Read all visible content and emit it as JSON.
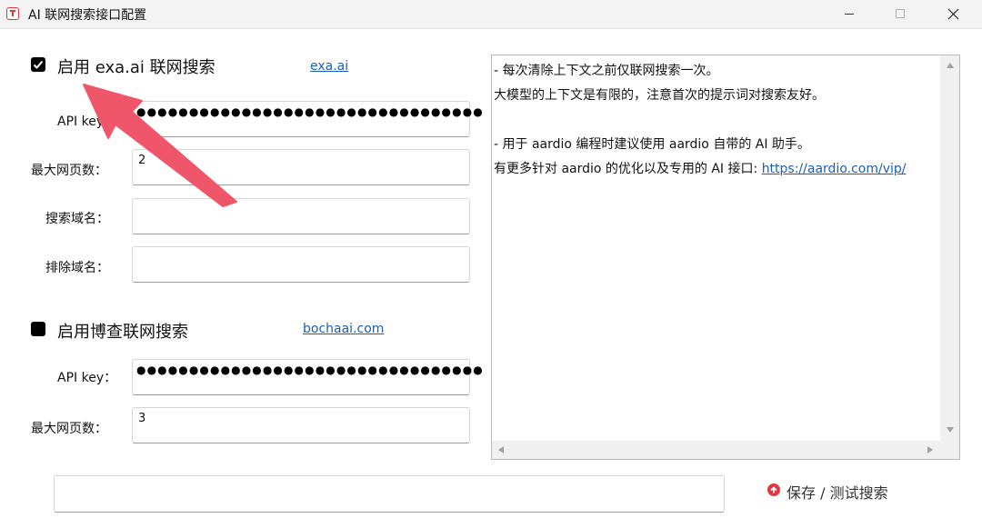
{
  "window": {
    "title": "AI 联网搜索接口配置"
  },
  "exa": {
    "enabled": true,
    "label": "启用 exa.ai 联网搜索",
    "link": "exa.ai",
    "api_key_label": "API key：",
    "api_key_masked": "●●●●●●●●●●●●●●●●●●●●●●●●●●●●●●●●●",
    "max_pages_label": "最大网页数：",
    "max_pages_value": "2",
    "search_domains_label": "搜索域名：",
    "search_domains_value": "",
    "exclude_domains_label": "排除域名：",
    "exclude_domains_value": ""
  },
  "bocha": {
    "enabled": false,
    "label": "启用博查联网搜索",
    "link": "bochaai.com",
    "api_key_label": "API key：",
    "api_key_masked": "●●●●●●●●●●●●●●●●●●●●●●●●●●●●●●●●●",
    "max_pages_label": "最大网页数：",
    "max_pages_value": "3"
  },
  "info": {
    "line1": "- 每次清除上下文之前仅联网搜索一次。",
    "line2": "大模型的上下文是有限的，注意首次的提示词对搜索友好。",
    "line3": "",
    "line4": "- 用于 aardio 编程时建议使用 aardio 自带的 AI 助手。",
    "line5_prefix": "有更多针对 aardio 的优化以及专用的 AI 接口: ",
    "line5_link": "https://aardio.com/vip/"
  },
  "actions": {
    "status_text": "",
    "save_label": "保存 / 测试搜索"
  },
  "colors": {
    "accent": "#e0383e",
    "link": "#1a5fb4",
    "annotation_arrow": "#f0566a"
  },
  "icons": {
    "app": "app-icon",
    "save": "arrow-up-circle-icon"
  }
}
